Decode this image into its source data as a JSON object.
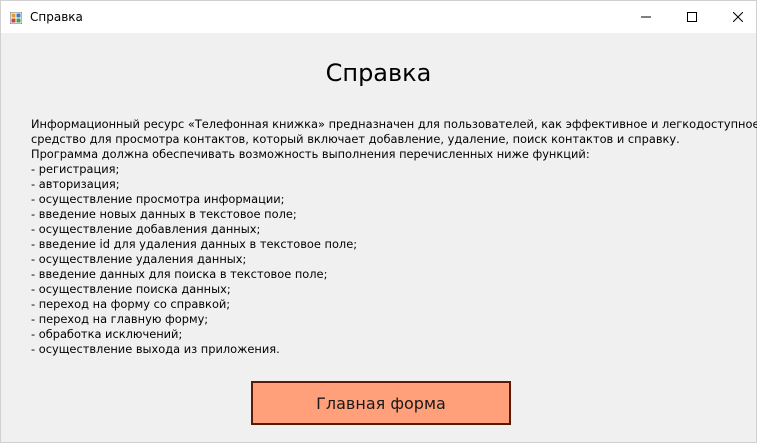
{
  "window": {
    "title": "Справка",
    "controls": {
      "minimize": "minimize-icon",
      "maximize": "maximize-icon",
      "close": "close-icon"
    }
  },
  "main": {
    "heading": "Справка",
    "lines": [
      "Информационный ресурс «Телефонная книжка»  предназначен для пользователей, как эффективное и легкодоступное",
      "средство для просмотра контактов, который включает добавление, удаление, поиск контактов и справку.",
      "Программа должна обеспечивать возможность выполнения перечисленных ниже функций:",
      "- регистрация;",
      "- авторизация;",
      "- осуществление просмотра информации;",
      "- введение новых данных в текстовое поле;",
      "- осуществление добавления данных;",
      "- введение id для удаления данных в текстовое поле;",
      "- осуществление удаления данных;",
      "- введение данных для поиска в текстовое поле;",
      "- осуществление поиска данных;",
      "- переход на форму со справкой;",
      "- переход на главную форму;",
      "- обработка исключений;",
      "- осуществление выхода из приложения."
    ],
    "main_form_button": "Главная форма"
  },
  "colors": {
    "button_bg": "#ffa07a",
    "button_border": "#5a1a08",
    "window_bg": "#f0f0f0"
  }
}
